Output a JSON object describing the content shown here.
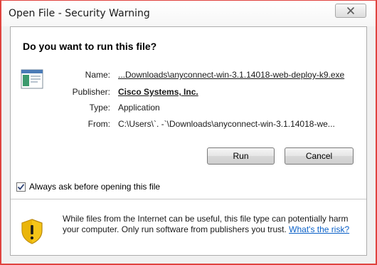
{
  "window": {
    "title": "Open File - Security Warning",
    "close_glyph": "✕"
  },
  "dialog": {
    "heading": "Do you want to run this file?",
    "file_icon": "executable-file-icon",
    "fields": {
      "name_label": "Name:",
      "name_value": "...Downloads\\anyconnect-win-3.1.14018-web-deploy-k9.exe",
      "publisher_label": "Publisher:",
      "publisher_value": "Cisco Systems, Inc.",
      "type_label": "Type:",
      "type_value": "Application",
      "from_label": "From:",
      "from_value": "C:\\Users\\`. -`\\Downloads\\anyconnect-win-3.1.14018-we..."
    },
    "buttons": {
      "run": "Run",
      "cancel": "Cancel"
    },
    "checkbox": {
      "label": "Always ask before opening this file",
      "checked": true
    },
    "warning": {
      "icon": "shield-warning-icon",
      "text": "While files from the Internet can be useful, this file type can potentially harm your computer. Only run software from publishers you trust.",
      "link": "What's the risk?"
    }
  },
  "colors": {
    "link": "#0a60c7",
    "border_accent": "#e0443f",
    "shield_yellow": "#f5c518"
  }
}
